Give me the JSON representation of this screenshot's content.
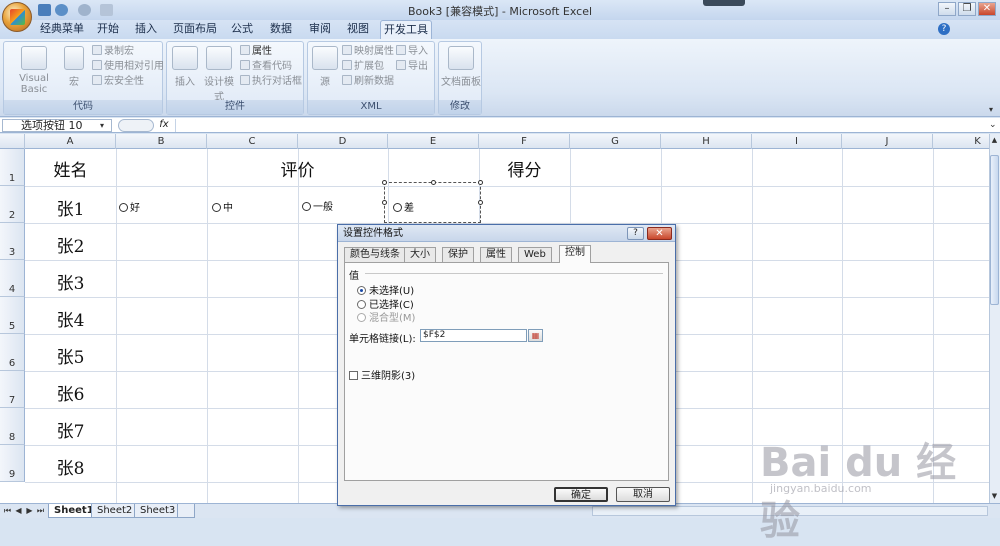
{
  "window": {
    "title": "Book3  [兼容模式] - Microsoft Excel",
    "min": "–",
    "restore": "❐",
    "close": "✕",
    "help": "?"
  },
  "tabs": [
    "经典菜单",
    "开始",
    "插入",
    "页面布局",
    "公式",
    "数据",
    "审阅",
    "视图",
    "开发工具"
  ],
  "ribbon": {
    "code": {
      "label": "代码",
      "visual_basic": "Visual Basic",
      "macro": "宏",
      "record_macro": "录制宏",
      "relative_ref": "使用相对引用",
      "macro_security": "宏安全性"
    },
    "controls": {
      "label": "控件",
      "insert": "插入",
      "design_mode": "设计模式",
      "properties": "属性",
      "view_code": "查看代码",
      "run_dialog": "执行对话框"
    },
    "xml": {
      "label": "XML",
      "source": "源",
      "map_props": "映射属性",
      "expansion": "扩展包",
      "refresh": "刷新数据",
      "import": "导入",
      "export": "导出"
    },
    "modify": {
      "label": "修改",
      "doc_panel": "文档面板"
    }
  },
  "formula_bar": {
    "name_box": "选项按钮 10",
    "fx": "fx",
    "formula": ""
  },
  "columns": [
    "A",
    "B",
    "C",
    "D",
    "E",
    "F",
    "G",
    "H",
    "I",
    "J",
    "K"
  ],
  "rows": [
    "1",
    "2",
    "3",
    "4",
    "5",
    "6",
    "7",
    "8",
    "9"
  ],
  "cells": {
    "A1": "姓名",
    "BE1": "评价",
    "F1": "得分",
    "names": [
      "张1",
      "张2",
      "张3",
      "张4",
      "张5",
      "张6",
      "张7",
      "张8"
    ]
  },
  "option_buttons": [
    "好",
    "中",
    "一般",
    "差"
  ],
  "sheets": [
    "Sheet1",
    "Sheet2",
    "Sheet3"
  ],
  "dialog": {
    "title": "设置控件格式",
    "tabs": [
      "颜色与线条",
      "大小",
      "保护",
      "属性",
      "Web",
      "控制"
    ],
    "active_tab": "控制",
    "value_label": "值",
    "options": [
      {
        "label": "未选择(U)",
        "checked": true
      },
      {
        "label": "已选择(C)",
        "checked": false
      },
      {
        "label": "混合型(M)",
        "checked": false,
        "disabled": true
      }
    ],
    "cell_link_label": "单元格链接(L):",
    "cell_link_value": "$F$2",
    "shading_label": "三维阴影(3)",
    "shading_checked": false,
    "ok": "确定",
    "cancel": "取消"
  },
  "watermark": {
    "text": "Bai du 经验",
    "sub": "jingyan.baidu.com"
  }
}
